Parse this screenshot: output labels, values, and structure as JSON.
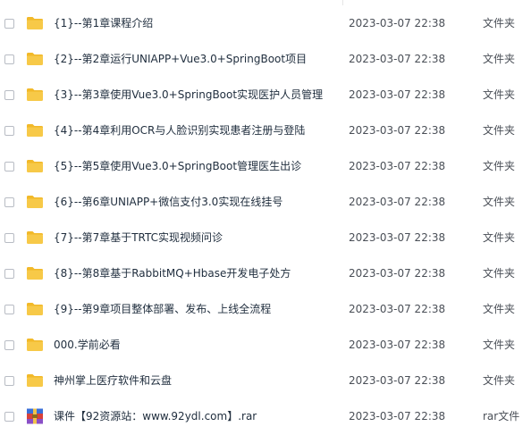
{
  "files": [
    {
      "name": "{1}--第1章课程介绍",
      "date": "2023-03-07 22:38",
      "type": "文件夹",
      "icon": "folder-icon"
    },
    {
      "name": "{2}--第2章运行UNIAPP+Vue3.0+SpringBoot项目",
      "date": "2023-03-07 22:38",
      "type": "文件夹",
      "icon": "folder-icon"
    },
    {
      "name": "{3}--第3章使用Vue3.0+SpringBoot实现医护人员管理",
      "date": "2023-03-07 22:38",
      "type": "文件夹",
      "icon": "folder-icon"
    },
    {
      "name": "{4}--第4章利用OCR与人脸识别实现患者注册与登陆",
      "date": "2023-03-07 22:38",
      "type": "文件夹",
      "icon": "folder-icon"
    },
    {
      "name": "{5}--第5章使用Vue3.0+SpringBoot管理医生出诊",
      "date": "2023-03-07 22:38",
      "type": "文件夹",
      "icon": "folder-icon"
    },
    {
      "name": "{6}--第6章UNIAPP+微信支付3.0实现在线挂号",
      "date": "2023-03-07 22:38",
      "type": "文件夹",
      "icon": "folder-icon"
    },
    {
      "name": "{7}--第7章基于TRTC实现视频问诊",
      "date": "2023-03-07 22:38",
      "type": "文件夹",
      "icon": "folder-icon"
    },
    {
      "name": "{8}--第8章基于RabbitMQ+Hbase开发电子处方",
      "date": "2023-03-07 22:38",
      "type": "文件夹",
      "icon": "folder-icon"
    },
    {
      "name": "{9}--第9章项目整体部署、发布、上线全流程",
      "date": "2023-03-07 22:38",
      "type": "文件夹",
      "icon": "folder-icon"
    },
    {
      "name": "000.学前必看",
      "date": "2023-03-07 22:38",
      "type": "文件夹",
      "icon": "folder-icon"
    },
    {
      "name": "神州掌上医疗软件和云盘",
      "date": "2023-03-07 22:38",
      "type": "文件夹",
      "icon": "folder-icon"
    },
    {
      "name": "课件【92资源站：www.92ydl.com】.rar",
      "date": "2023-03-07 22:38",
      "type": "rar文件",
      "icon": "rar-archive-icon"
    }
  ],
  "colors": {
    "folder": "#f7c948",
    "folder_tab": "#f2b929"
  }
}
